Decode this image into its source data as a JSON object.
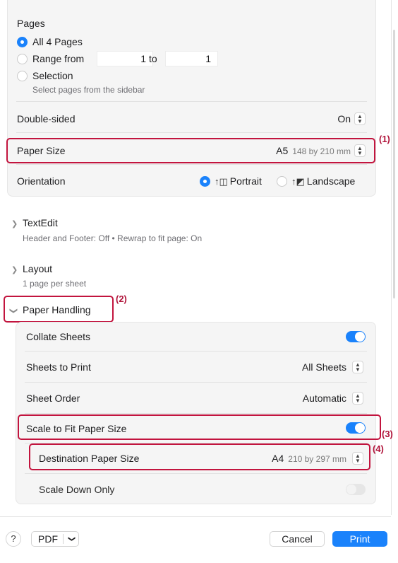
{
  "pages": {
    "title": "Pages",
    "all_label": "All 4 Pages",
    "range_label": "Range from",
    "range_from": "1",
    "range_to_label": "to",
    "range_to": "1",
    "selection_label": "Selection",
    "selection_hint": "Select pages from the sidebar"
  },
  "double_sided": {
    "label": "Double-sided",
    "value": "On"
  },
  "paper_size": {
    "label": "Paper Size",
    "value": "A5",
    "dims": "148 by 210 mm",
    "annotation": "(1)"
  },
  "orientation": {
    "label": "Orientation",
    "portrait": "Portrait",
    "landscape": "Landscape",
    "selected": "Portrait"
  },
  "textedit": {
    "title": "TextEdit",
    "summary": "Header and Footer: Off • Rewrap to fit page: On"
  },
  "layout": {
    "title": "Layout",
    "summary": "1 page per sheet"
  },
  "paper_handling": {
    "title": "Paper Handling",
    "annotation": "(2)",
    "collate_label": "Collate Sheets",
    "collate_on": true,
    "sheets_label": "Sheets to Print",
    "sheets_value": "All Sheets",
    "order_label": "Sheet Order",
    "order_value": "Automatic",
    "scale_label": "Scale to Fit Paper Size",
    "scale_on": true,
    "scale_annotation": "(3)",
    "dest_label": "Destination Paper Size",
    "dest_value": "A4",
    "dest_dims": "210 by 297 mm",
    "dest_annotation": "(4)",
    "scale_down_label": "Scale Down Only",
    "scale_down_on": false
  },
  "footer": {
    "help": "?",
    "pdf": "PDF",
    "cancel": "Cancel",
    "print": "Print"
  },
  "colors": {
    "accent": "#1a82fb",
    "annotation": "#c2143e"
  },
  "icons": [
    "chevron-right-icon",
    "chevron-down-icon",
    "stepper-icon",
    "portrait-icon",
    "landscape-icon",
    "help-icon"
  ]
}
